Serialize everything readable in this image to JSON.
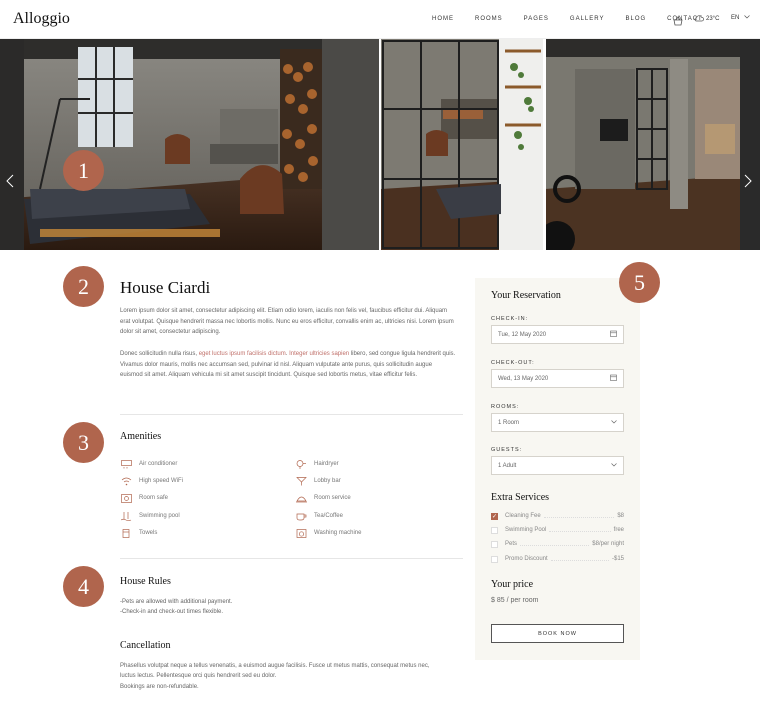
{
  "header": {
    "logo": "Alloggio",
    "nav": [
      "HOME",
      "ROOMS",
      "PAGES",
      "GALLERY",
      "BLOG",
      "CONTACT"
    ],
    "weather": "23°C",
    "language": "EN",
    "icons": [
      "basket-icon",
      "cloud-icon",
      "chevron-down-icon"
    ]
  },
  "gallery": {
    "prev_icon": "chevron-left",
    "next_icon": "chevron-right"
  },
  "markers": [
    "1",
    "2",
    "3",
    "4",
    "5"
  ],
  "room": {
    "title": "House Ciardi",
    "p1": "Lorem ipsum dolor sit amet, consectetur adipiscing elit. Etiam odio lorem, iaculis non felis vel, faucibus efficitur dui. Aliquam erat volutpat. Quisque hendrerit massa nec lobortis mollis. Nunc eu eros efficitur, convallis enim ac, ultricies nisi. Lorem ipsum dolor sit amet, consectetur adipiscing.",
    "p2_start": "Donec sollicitudin nulla risus, ",
    "p2_accent1": "eget luctus ipsum facilisis dictum",
    "p2_mid": ". ",
    "p2_accent2": "Integer ultricies sapien",
    "p2_end": " libero, sed congue ligula hendrerit quis. Vivamus dolor mauris, mollis nec accumsan sed, pulvinar id nisl. Aliquam vulputate ante purus, quis sollicitudin augue euismod sit amet. Aliquam vehicula mi sit amet suscipit tincidunt. Quisque sed lobortis metus, vitae efficitur felis."
  },
  "amenities": {
    "title": "Amenities",
    "left": [
      {
        "label": "Air conditioner",
        "icon": "air-conditioner-icon"
      },
      {
        "label": "High speed WiFi",
        "icon": "wifi-icon"
      },
      {
        "label": "Room safe",
        "icon": "safe-icon"
      },
      {
        "label": "Swimming pool",
        "icon": "pool-icon"
      },
      {
        "label": "Towels",
        "icon": "towel-icon"
      }
    ],
    "right": [
      {
        "label": "Hairdryer",
        "icon": "hairdryer-icon"
      },
      {
        "label": "Lobby bar",
        "icon": "cocktail-icon"
      },
      {
        "label": "Room service",
        "icon": "cloche-icon"
      },
      {
        "label": "Tea/Coffee",
        "icon": "cup-icon"
      },
      {
        "label": "Washing machine",
        "icon": "washing-machine-icon"
      }
    ]
  },
  "rules": {
    "title": "House Rules",
    "line1": "-Pets are allowed with additional payment.",
    "line2": "-Check-in and check-out times flexible."
  },
  "cancellation": {
    "title": "Cancellation",
    "line1": "Phasellus volutpat neque a tellus venenatis, a euismod augue facilisis. Fusce ut metus mattis, consequat metus nec,",
    "line2": "luctus lectus. Pellentesque orci quis hendrerit sed eu dolor.",
    "line3": "Bookings are non-refundable."
  },
  "reservation": {
    "title": "Your Reservation",
    "checkin_label": "CHECK-IN:",
    "checkin_value": "Tue, 12 May 2020",
    "checkout_label": "CHECK-OUT:",
    "checkout_value": "Wed, 13 May 2020",
    "rooms_label": "ROOMS:",
    "rooms_value": "1 Room",
    "guests_label": "GUESTS:",
    "guests_value": "1 Adult",
    "extra_title": "Extra Services",
    "services": [
      {
        "name": "Cleaning Fee",
        "price": "$8",
        "checked": true
      },
      {
        "name": "Swimming Pool",
        "price": "free",
        "checked": false
      },
      {
        "name": "Pets",
        "price": "$8/per night",
        "checked": false
      },
      {
        "name": "Promo Discount",
        "price": "-$15",
        "checked": false
      }
    ],
    "price_title": "Your price",
    "price_value": "$ 85 / per room",
    "book_label": "BOOK NOW"
  },
  "colors": {
    "accent": "#b0654d",
    "panel": "#f8f7f2"
  }
}
